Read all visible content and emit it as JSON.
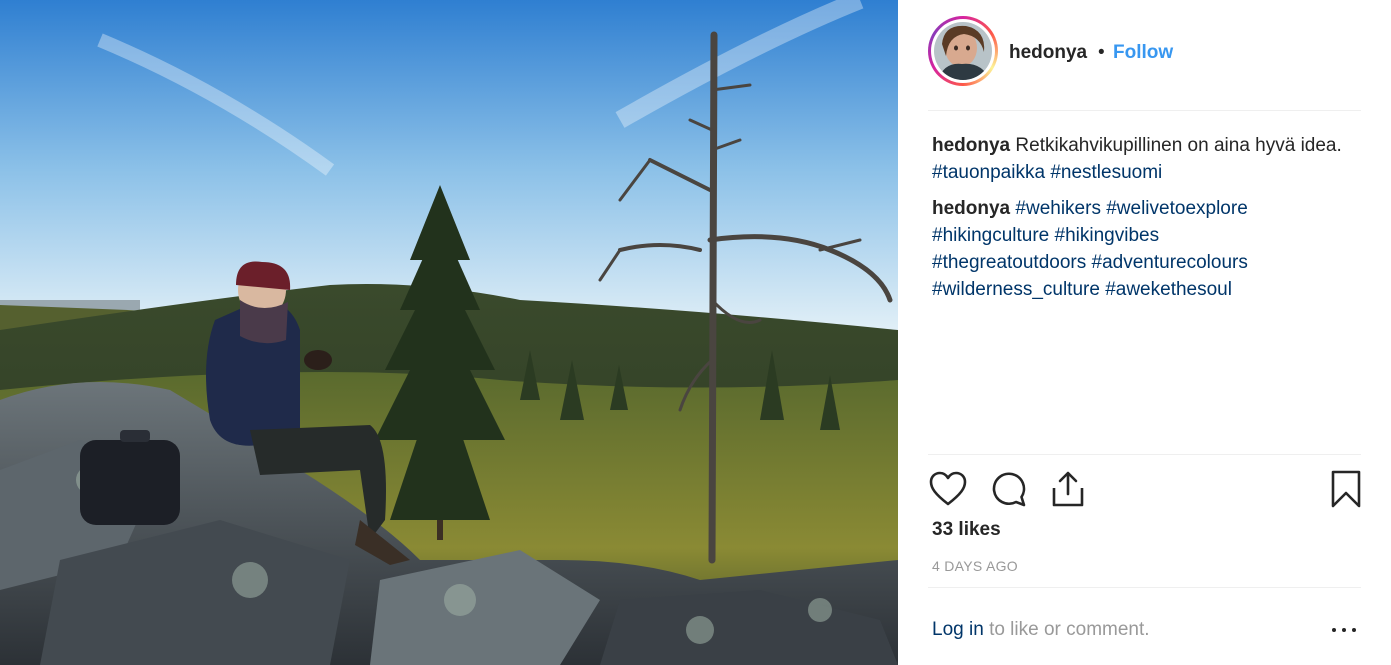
{
  "post": {
    "photo": {
      "icon": "forest-hiker-photo",
      "colors": {
        "sky_top": "#2f7fd1",
        "sky_bottom": "#d9ecf7",
        "forest": "#2e3c21",
        "rock": "#4a5058"
      }
    },
    "author": {
      "username": "hedonya",
      "separator": "•",
      "follow_label": "Follow",
      "colors": {
        "follow": "#3897f0",
        "ring_start": "#d6249f",
        "ring_end": "#fd5949"
      }
    },
    "comments": [
      {
        "user": "hedonya",
        "text": "Retkikahvikupillinen on aina hyvä idea.",
        "hashtags": [
          "#tauonpaikka",
          "#nestlesuomi"
        ]
      },
      {
        "user": "hedonya",
        "text": "",
        "hashtags": [
          "#wehikers",
          "#welivetoexplore",
          "#hikingculture",
          "#hikingvibes",
          "#thegreatoutdoors",
          "#adventurecolours",
          "#wilderness_culture",
          "#awekethesoul"
        ]
      }
    ],
    "actions": {
      "like": "heart-icon",
      "comment": "comment-bubble-icon",
      "share": "share-icon",
      "save": "bookmark-icon"
    },
    "likes_text": "33 likes",
    "time_ago": "4 DAYS AGO",
    "login": {
      "link": "Log in",
      "rest": "to like or comment."
    },
    "more_icon": "more-options-icon",
    "colors": {
      "hashtag": "#003569",
      "muted": "#999999",
      "divider": "#efefef"
    }
  }
}
